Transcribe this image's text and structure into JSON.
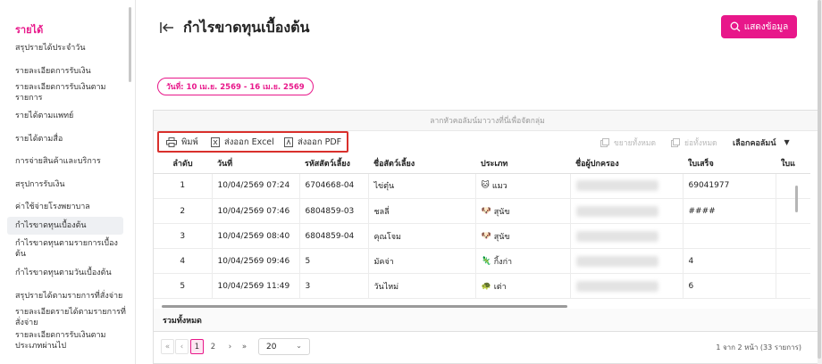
{
  "sidebar": {
    "section": "รายได้",
    "items": [
      {
        "label": "สรุปรายได้ประจำวัน"
      },
      {
        "label": "รายละเอียดการรับเงิน"
      },
      {
        "label": "รายละเอียดการรับเงินตามรายการ"
      },
      {
        "label": "รายได้ตามแพทย์"
      },
      {
        "label": "รายได้ตามสื่อ"
      },
      {
        "label": "การจ่ายสินค้าและบริการ"
      },
      {
        "label": "สรุปการรับเงิน"
      },
      {
        "label": "ค่าใช้จ่ายโรงพยาบาล"
      },
      {
        "label": "กำไรขาดทุนเบื้องต้น"
      },
      {
        "label": "กำไรขาดทุนตามรายการเบื้องต้น"
      },
      {
        "label": "กำไรขาดทุนตามวันเบื้องต้น"
      },
      {
        "label": "สรุปรายได้ตามรายการที่สั่งจ่าย"
      },
      {
        "label": "รายละเอียดรายได้ตามรายการที่สั่งจ่าย"
      },
      {
        "label": "รายละเอียดการรับเงินตามประเภทผ่านไป"
      }
    ]
  },
  "header": {
    "title": "กำไรขาดทุนเบื้องต้น",
    "show_button": "แสดงข้อมูล",
    "date_range": "วันที่: 10 เม.ย. 2569 - 16 เม.ย. 2569"
  },
  "grid": {
    "group_panel": "ลากหัวคอลัมน์มาวางที่นี่เพื่อจัดกลุ่ม",
    "toolbar": {
      "print": "พิมพ์",
      "excel": "ส่งออก Excel",
      "pdf": "ส่งออก PDF",
      "expand_all": "ขยายทั้งหมด",
      "collapse_all": "ย่อทั้งหมด",
      "choose_columns": "เลือกคอลัมน์"
    },
    "columns": [
      "ลำดับ",
      "วันที่",
      "รหัสสัตว์เลี้ยง",
      "ชื่อสัตว์เลี้ยง",
      "ประเภท",
      "ชื่อผู้ปกครอง",
      "ใบเสร็จ",
      "ใบแ"
    ],
    "rows": [
      {
        "no": "1",
        "date": "10/04/2569 07:24",
        "pet_id": "6704668-04",
        "pet_name": "ไข่ตุ๋น",
        "type": "แมว",
        "type_icon": "cat-icon",
        "receipt": "69041977"
      },
      {
        "no": "2",
        "date": "10/04/2569 07:46",
        "pet_id": "6804859-03",
        "pet_name": "ชลลี่",
        "type": "สุนัข",
        "type_icon": "dog-icon",
        "receipt": "####"
      },
      {
        "no": "3",
        "date": "10/04/2569 08:40",
        "pet_id": "6804859-04",
        "pet_name": "คุณโจม",
        "type": "สุนัข",
        "type_icon": "dog-icon",
        "receipt": ""
      },
      {
        "no": "4",
        "date": "10/04/2569 09:46",
        "pet_id": "5",
        "pet_name": "มัคจ่า",
        "type": "กิ้งก่า",
        "type_icon": "lizard-icon",
        "receipt": "4"
      },
      {
        "no": "5",
        "date": "10/04/2569 11:49",
        "pet_id": "3",
        "pet_name": "วันไหม่",
        "type": "เต่า",
        "type_icon": "turtle-icon",
        "receipt": "6"
      }
    ],
    "total_label": "รวมทั้งหมด",
    "pager": {
      "pages": [
        "1",
        "2"
      ],
      "current": "1",
      "page_size": "20",
      "info": "1 จาก 2 หน้า (33 รายการ)"
    }
  },
  "colors": {
    "accent": "#e8178a",
    "highlight": "#d9302c"
  }
}
